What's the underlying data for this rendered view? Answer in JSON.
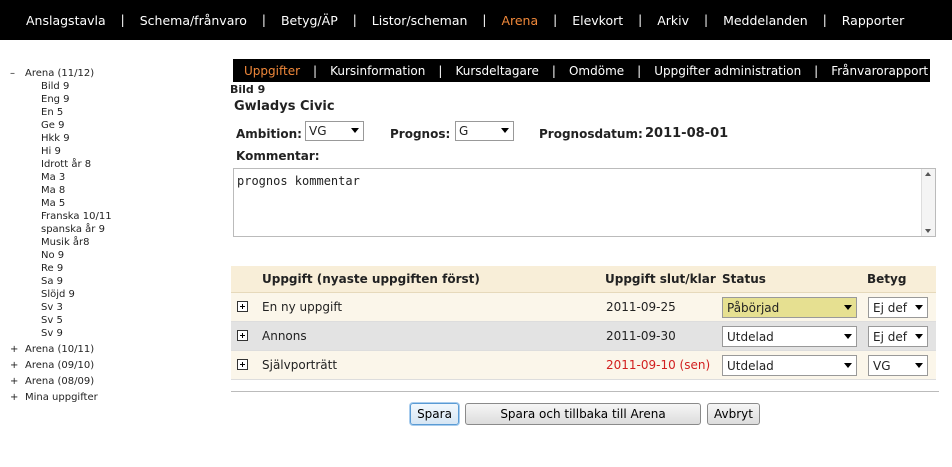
{
  "topnav": [
    {
      "label": "Anslagstavla",
      "active": false
    },
    {
      "label": "Schema/frånvaro",
      "active": false
    },
    {
      "label": "Betyg/ÄP",
      "active": false
    },
    {
      "label": "Listor/scheman",
      "active": false
    },
    {
      "label": "Arena",
      "active": true
    },
    {
      "label": "Elevkort",
      "active": false
    },
    {
      "label": "Arkiv",
      "active": false
    },
    {
      "label": "Meddelanden",
      "active": false
    },
    {
      "label": "Rapporter",
      "active": false
    }
  ],
  "sidebar": {
    "groups": [
      {
        "toggle": "–",
        "label": "Arena (11/12)",
        "open": true,
        "items": [
          "Bild 9",
          "Eng 9",
          "En 5",
          "Ge 9",
          "Hkk 9",
          "Hi 9",
          "Idrott år 8",
          "Ma 3",
          "Ma 8",
          "Ma 5",
          "Franska 10/11",
          "spanska år 9",
          "Musik år8",
          "No 9",
          "Re 9",
          "Sa 9",
          "Slöjd 9",
          "Sv 3",
          "Sv 5",
          "Sv 9"
        ]
      },
      {
        "toggle": "+",
        "label": "Arena (10/11)",
        "open": false,
        "items": []
      },
      {
        "toggle": "+",
        "label": "Arena (09/10)",
        "open": false,
        "items": []
      },
      {
        "toggle": "+",
        "label": "Arena (08/09)",
        "open": false,
        "items": []
      },
      {
        "toggle": "+",
        "label": "Mina uppgifter",
        "open": false,
        "items": []
      }
    ]
  },
  "subnav": [
    {
      "label": "Uppgifter",
      "active": true
    },
    {
      "label": "Kursinformation",
      "active": false
    },
    {
      "label": "Kursdeltagare",
      "active": false
    },
    {
      "label": "Omdöme",
      "active": false
    },
    {
      "label": "Uppgifter administration",
      "active": false
    },
    {
      "label": "Frånvarorapport",
      "active": false
    }
  ],
  "course": "Bild 9",
  "student": "Gwladys Civic",
  "form": {
    "ambition_label": "Ambition:",
    "ambition_value": "VG",
    "prognos_label": "Prognos:",
    "prognos_value": "G",
    "prognosdatum_label": "Prognosdatum:",
    "prognosdatum_value": "2011-08-01",
    "kommentar_label": "Kommentar:",
    "kommentar_value": "prognos kommentar"
  },
  "table": {
    "headers": {
      "task": "Uppgift (nyaste uppgiften först)",
      "date": "Uppgift slut/klar",
      "status": "Status",
      "grade": "Betyg"
    },
    "rows": [
      {
        "task": "En ny uppgift",
        "date": "2011-09-25",
        "late": false,
        "status": "Påbörjad",
        "grade": "Ej def"
      },
      {
        "task": "Annons",
        "date": "2011-09-30",
        "late": false,
        "status": "Utdelad",
        "grade": "Ej def"
      },
      {
        "task": "Självporträtt",
        "date": "2011-09-10 (sen)",
        "late": true,
        "status": "Utdelad",
        "grade": "VG"
      }
    ]
  },
  "buttons": {
    "save": "Spara",
    "save_back": "Spara och tillbaka till Arena",
    "cancel": "Avbryt"
  },
  "colors": {
    "accent": "#f0883a",
    "late": "#d21f1f",
    "highlight_select": "#e6e091"
  }
}
